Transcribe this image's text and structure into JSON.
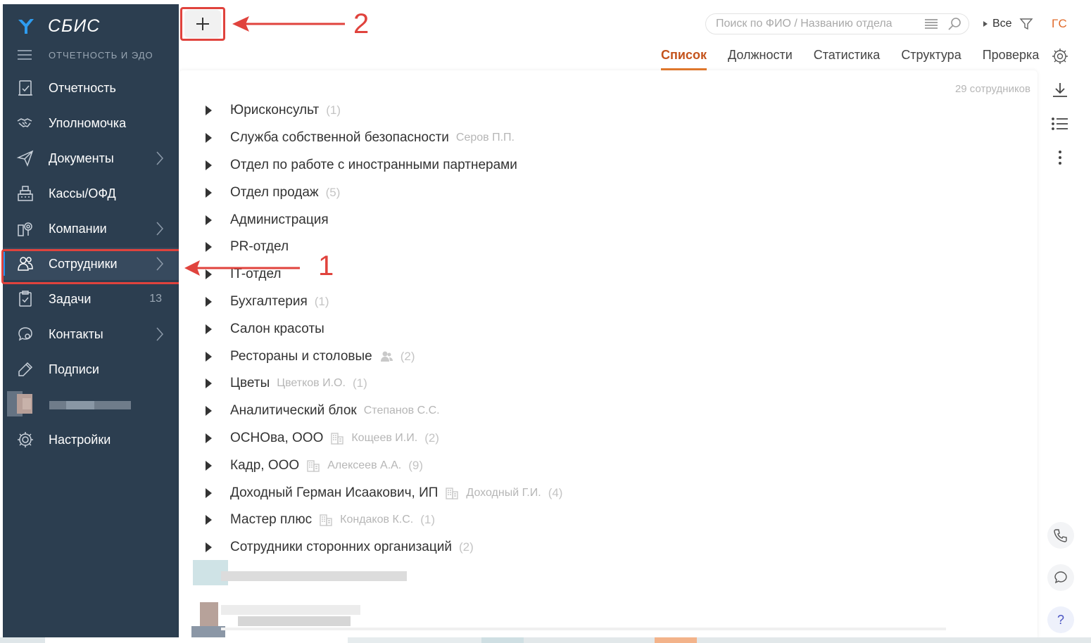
{
  "app": {
    "brand": "СБИС",
    "subtitle": "ОТЧЕТНОСТЬ И ЭДО"
  },
  "sidebar": {
    "items": [
      {
        "label": "Отчетность",
        "icon": "report-icon",
        "chevron": false,
        "badge": ""
      },
      {
        "label": "Уполномочка",
        "icon": "handshake-icon",
        "chevron": false,
        "badge": ""
      },
      {
        "label": "Документы",
        "icon": "paper-plane-icon",
        "chevron": true,
        "badge": ""
      },
      {
        "label": "Кассы/ОФД",
        "icon": "cash-register-icon",
        "chevron": false,
        "badge": ""
      },
      {
        "label": "Компании",
        "icon": "company-icon",
        "chevron": true,
        "badge": ""
      },
      {
        "label": "Сотрудники",
        "icon": "employees-icon",
        "chevron": true,
        "badge": "",
        "active": true
      },
      {
        "label": "Задачи",
        "icon": "tasks-icon",
        "chevron": false,
        "badge": "13"
      },
      {
        "label": "Контакты",
        "icon": "chat-icon",
        "chevron": true,
        "badge": ""
      },
      {
        "label": "Подписи",
        "icon": "signature-icon",
        "chevron": false,
        "badge": ""
      },
      {
        "label": "Настройки",
        "icon": "gear-icon",
        "chevron": false,
        "badge": ""
      }
    ]
  },
  "header": {
    "search_placeholder": "Поиск по ФИО / Названию отдела",
    "filter_label": "Все",
    "user_initials": "ГС",
    "tabs": [
      {
        "label": "Список",
        "active": true
      },
      {
        "label": "Должности",
        "active": false
      },
      {
        "label": "Статистика",
        "active": false
      },
      {
        "label": "Структура",
        "active": false
      },
      {
        "label": "Проверка",
        "active": false
      }
    ]
  },
  "content": {
    "employee_count": "29 сотрудников",
    "departments": [
      {
        "name": "Юрисконсульт",
        "manager": "",
        "count": "(1)",
        "icon": ""
      },
      {
        "name": "Служба собственной безопасности",
        "manager": "Серов П.П.",
        "count": "",
        "icon": ""
      },
      {
        "name": "Отдел по работе с иностранными партнерами",
        "manager": "",
        "count": "",
        "icon": ""
      },
      {
        "name": "Отдел продаж",
        "manager": "",
        "count": "(5)",
        "icon": ""
      },
      {
        "name": "Администрация",
        "manager": "",
        "count": "",
        "icon": ""
      },
      {
        "name": "PR-отдел",
        "manager": "",
        "count": "",
        "icon": ""
      },
      {
        "name": "IT-отдел",
        "manager": "",
        "count": "",
        "icon": ""
      },
      {
        "name": "Бухгалтерия",
        "manager": "",
        "count": "(1)",
        "icon": ""
      },
      {
        "name": "Салон красоты",
        "manager": "",
        "count": "",
        "icon": ""
      },
      {
        "name": "Рестораны и столовые",
        "manager": "",
        "count": "(2)",
        "icon": "people"
      },
      {
        "name": "Цветы",
        "manager": "Цветков И.О.",
        "count": "(1)",
        "icon": ""
      },
      {
        "name": "Аналитический блок",
        "manager": "Степанов С.С.",
        "count": "",
        "icon": ""
      },
      {
        "name": "ОСНОва, ООО",
        "manager": "Кощеев И.И.",
        "count": "(2)",
        "icon": "building"
      },
      {
        "name": "Кадр, ООО",
        "manager": "Алексеев А.А.",
        "count": "(9)",
        "icon": "building"
      },
      {
        "name": "Доходный Герман Исаакович, ИП",
        "manager": "Доходный Г.И.",
        "count": "(4)",
        "icon": "building"
      },
      {
        "name": "Мастер плюс",
        "manager": "Кондаков К.С.",
        "count": "(1)",
        "icon": "building"
      },
      {
        "name": "Сотрудники сторонних организаций",
        "manager": "",
        "count": "(2)",
        "icon": ""
      }
    ]
  },
  "annotations": {
    "first": "1",
    "second": "2"
  },
  "colors": {
    "sidebar": "#2c3e50",
    "accent": "#e47a2e",
    "callout": "#e0433d",
    "active_tab": "#c4531c"
  }
}
